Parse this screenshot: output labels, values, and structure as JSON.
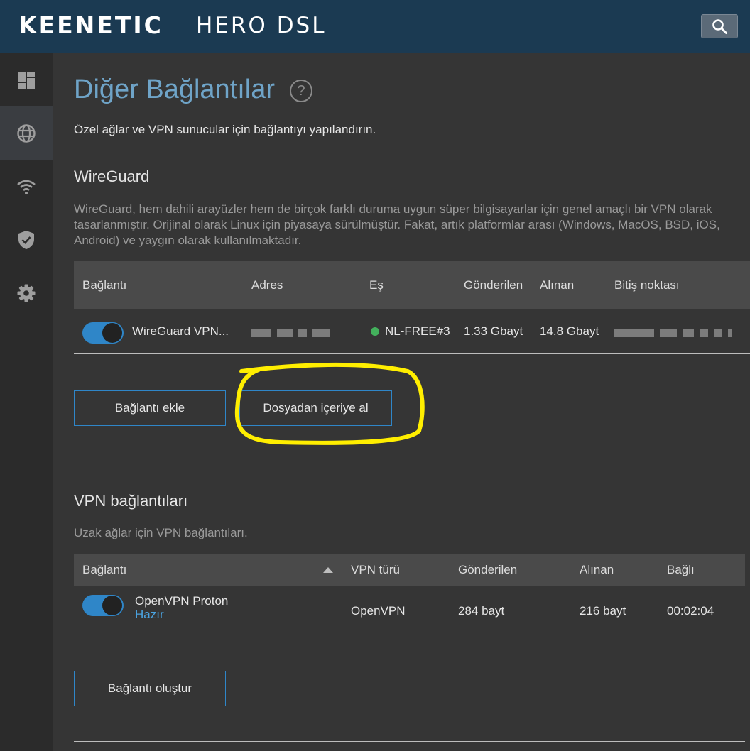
{
  "header": {
    "brand": "KEENETIC",
    "model": "HERO DSL"
  },
  "sidebar": {
    "items": [
      {
        "name": "dashboard",
        "icon": "dashboard-icon"
      },
      {
        "name": "internet",
        "icon": "globe-icon",
        "active": true
      },
      {
        "name": "wifi",
        "icon": "wifi-icon"
      },
      {
        "name": "security",
        "icon": "shield-icon"
      },
      {
        "name": "settings",
        "icon": "gear-icon"
      }
    ]
  },
  "page": {
    "title": "Diğer Bağlantılar",
    "subtitle": "Özel ağlar ve VPN sunucular için bağlantıyı yapılandırın."
  },
  "wireguard": {
    "title": "WireGuard",
    "description": "WireGuard, hem dahili arayüzler hem de birçok farklı duruma uygun süper bilgisayarlar için genel amaçlı bir VPN olarak tasarlanmıştır. Orijinal olarak Linux için piyasaya sürülmüştür. Fakat, artık platformlar arası (Windows, MacOS, BSD, iOS, Android) ve yaygın olarak kullanılmaktadır.",
    "columns": [
      "Bağlantı",
      "Adres",
      "Eş",
      "Gönderilen",
      "Alınan",
      "Bitiş noktası"
    ],
    "rows": [
      {
        "name": "WireGuard VPN...",
        "peer": "NL-FREE#3",
        "sent": "1.33 Gbayt",
        "received": "14.8 Gbayt",
        "enabled": true
      }
    ],
    "add_button": "Bağlantı ekle",
    "import_button": "Dosyadan içeriye al"
  },
  "vpn": {
    "title": "VPN bağlantıları",
    "description": "Uzak ağlar için VPN bağlantıları.",
    "columns": [
      "Bağlantı",
      "VPN türü",
      "Gönderilen",
      "Alınan",
      "Bağlı"
    ],
    "rows": [
      {
        "name": "OpenVPN Proton",
        "status": "Hazır",
        "type": "OpenVPN",
        "sent": "284 bayt",
        "received": "216 bayt",
        "uptime": "00:02:04",
        "enabled": true
      }
    ],
    "create_button": "Bağlantı oluştur"
  },
  "colors": {
    "header_bg": "#1b3a52",
    "accent": "#2f86c8",
    "title": "#6fa4c8",
    "highlight": "#ffee00",
    "status_ok": "#43b05c"
  }
}
